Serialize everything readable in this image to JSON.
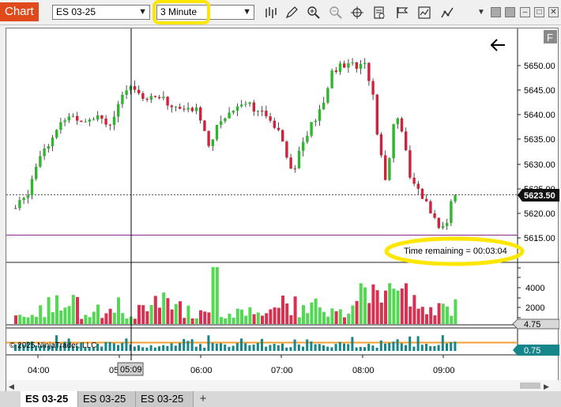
{
  "toolbar": {
    "chart_label": "Chart",
    "instrument": "ES 03-25",
    "interval": "3 Minute",
    "icons": [
      "bar-style-icon",
      "draw-pencil-icon",
      "zoom-in-icon",
      "zoom-out-icon",
      "crosshair-icon",
      "data-box-icon",
      "strategy-icon",
      "indicators-icon",
      "chart-trader-icon"
    ],
    "highlight_color": "#ffe600"
  },
  "chart": {
    "f_button": "F",
    "price_ticks": [
      "5650.00",
      "5645.00",
      "5640.00",
      "5635.00",
      "5630.00",
      "5625.00",
      "5620.00",
      "5615.00"
    ],
    "last_price_label": "5623.50",
    "time_remaining": "Time remaining = 00:03:04",
    "volume_ticks": [
      "4000",
      "2000"
    ],
    "indicator_a_value": "4.75",
    "indicator_b_value": "0.75",
    "copyright": "© 2025 NinjaTrader, LLC",
    "time_ticks": [
      "04:00",
      "05:00",
      "06:00",
      "07:00",
      "08:00",
      "09:00"
    ],
    "crosshair_time": "05:09",
    "colors": {
      "up": "#2fb52f",
      "down": "#d0223a",
      "vol_up": "#52d852",
      "vol_down": "#d83050",
      "teal": "#17868a",
      "orange": "#f0a030",
      "purple": "#8a2a8a"
    }
  },
  "tabs": [
    {
      "label": "ES 03-25",
      "active": true
    },
    {
      "label": "ES 03-25",
      "active": false
    },
    {
      "label": "ES 03-25",
      "active": false
    }
  ],
  "add_tab": "+"
}
